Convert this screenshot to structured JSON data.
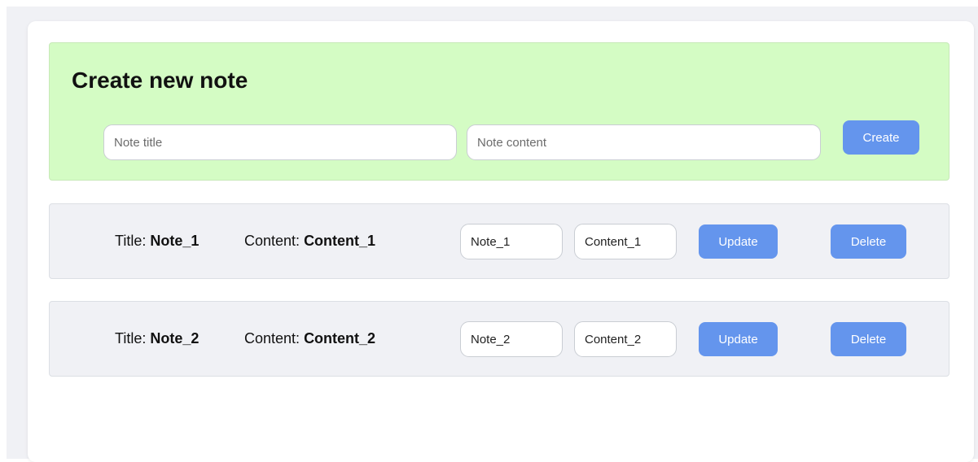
{
  "create": {
    "heading": "Create new note",
    "title_placeholder": "Note title",
    "content_placeholder": "Note content",
    "title_value": "",
    "content_value": "",
    "button_label": "Create"
  },
  "labels": {
    "title_prefix": "Title:",
    "content_prefix": "Content:"
  },
  "notes": [
    {
      "title": "Note_1",
      "content": "Content_1",
      "title_input": "Note_1",
      "content_input": "Content_1",
      "update_label": "Update",
      "delete_label": "Delete"
    },
    {
      "title": "Note_2",
      "content": "Content_2",
      "title_input": "Note_2",
      "content_input": "Content_2",
      "update_label": "Update",
      "delete_label": "Delete"
    }
  ],
  "colors": {
    "page_background": "#f0f1f5",
    "create_panel": "#d4fcc4",
    "button": "#6495ed",
    "note_row": "#f0f1f5"
  }
}
